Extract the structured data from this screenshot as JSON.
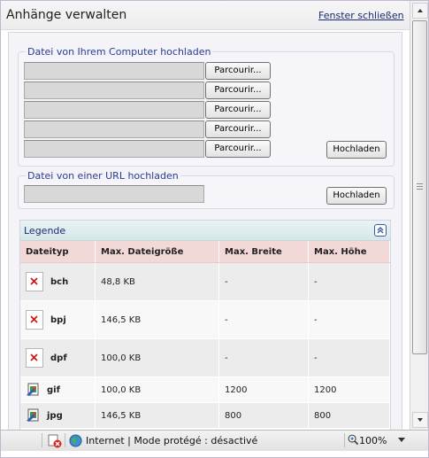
{
  "window": {
    "title": "Anhänge verwalten",
    "close_link": "Fenster schließen"
  },
  "local_upload": {
    "legend": "Datei von Ihrem Computer hochladen",
    "browse_label": "Parcourir...",
    "upload_label": "Hochladen",
    "file_values": [
      "",
      "",
      "",
      "",
      ""
    ]
  },
  "url_upload": {
    "legend": "Datei von einer URL hochladen",
    "url_value": "",
    "upload_label": "Hochladen"
  },
  "legend_panel": {
    "title": "Legende",
    "columns": [
      "Dateityp",
      "Max. Dateigröße",
      "Max. Breite",
      "Max. Höhe"
    ],
    "rows": [
      {
        "type": "bch",
        "size": "48,8 KB",
        "width": "-",
        "height": "-",
        "icon": "missing-image-icon"
      },
      {
        "type": "bpj",
        "size": "146,5 KB",
        "width": "-",
        "height": "-",
        "icon": "missing-image-icon"
      },
      {
        "type": "dpf",
        "size": "100,0 KB",
        "width": "-",
        "height": "-",
        "icon": "missing-image-icon"
      },
      {
        "type": "gif",
        "size": "100,0 KB",
        "width": "1200",
        "height": "1200",
        "icon": "image-file-icon"
      },
      {
        "type": "jpg",
        "size": "146,5 KB",
        "width": "800",
        "height": "800",
        "icon": "image-file-icon"
      }
    ]
  },
  "statusbar": {
    "zone_text": "Internet | Mode protégé : désactivé",
    "zoom": "100%"
  },
  "colors": {
    "link": "#1b2a78",
    "header_row": "#f3d8d8",
    "legend_header": "#d5e7e7"
  }
}
